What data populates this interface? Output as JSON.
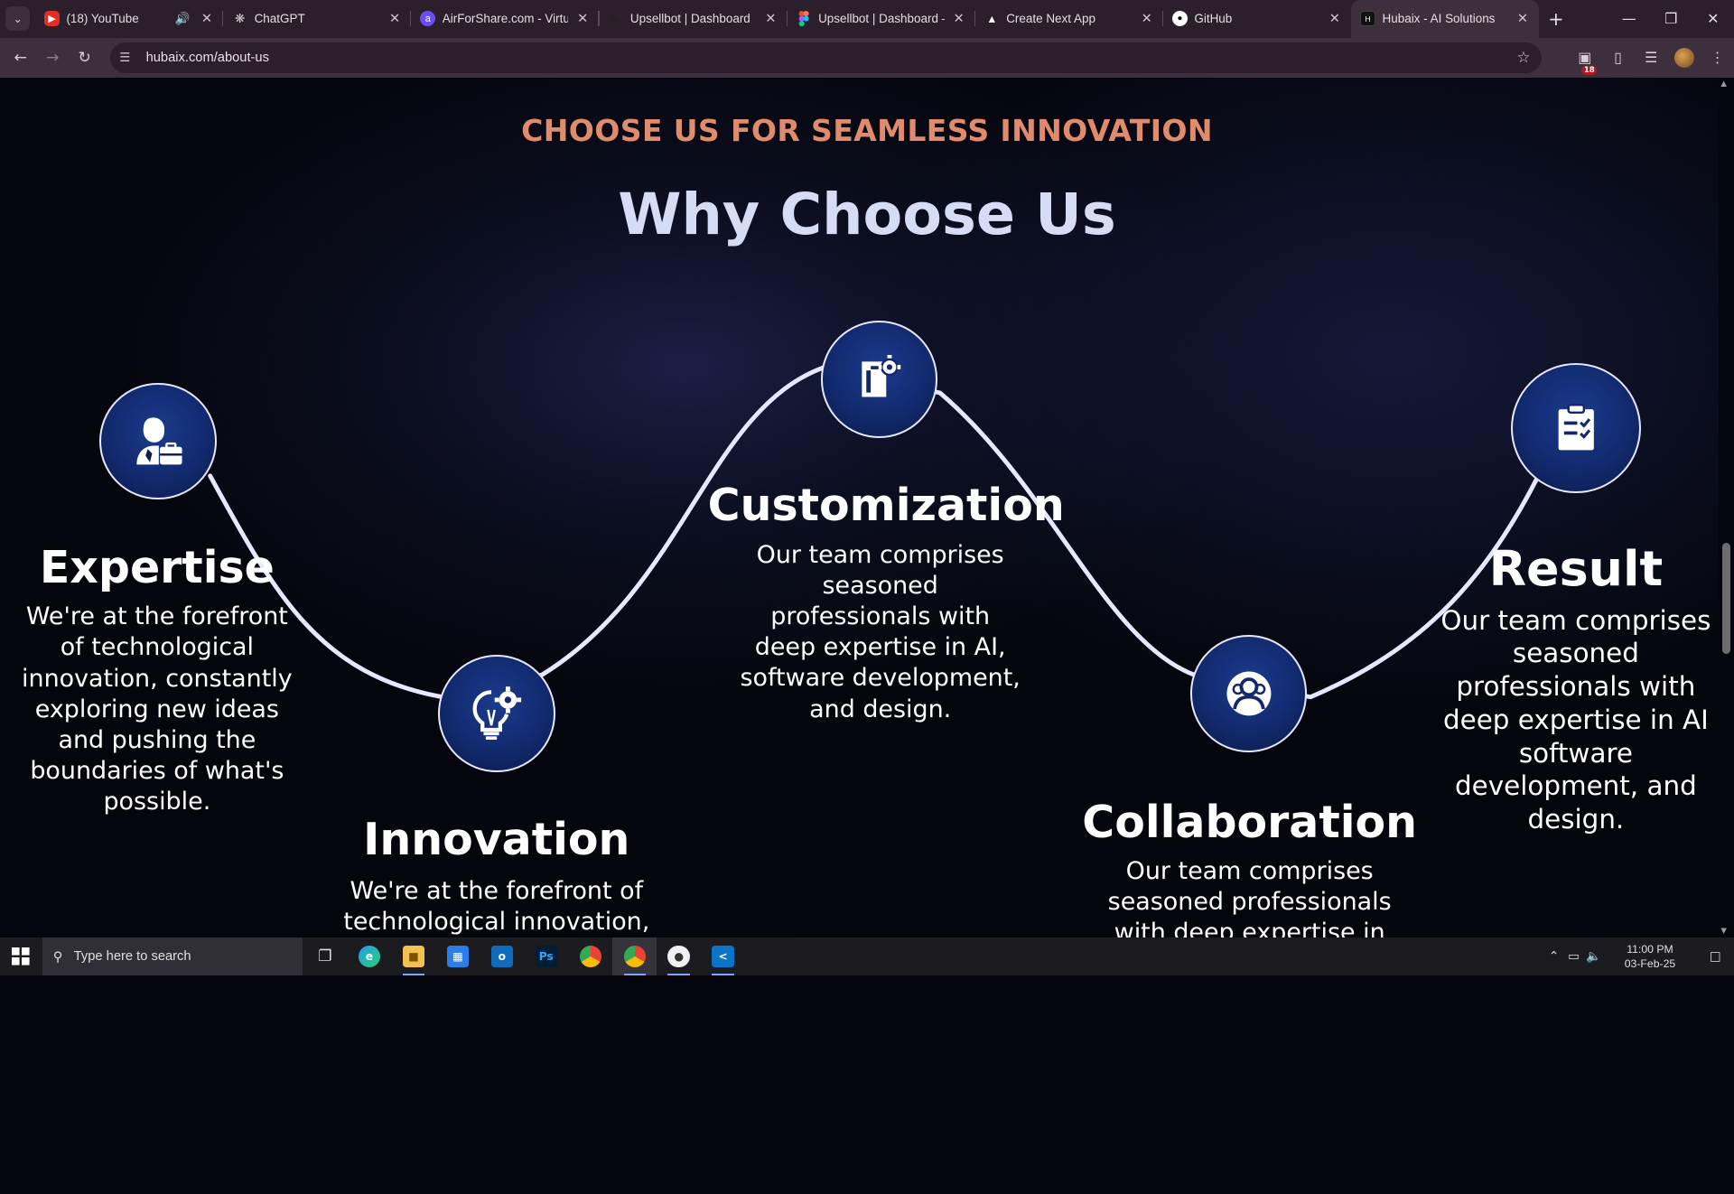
{
  "browser": {
    "tabs": [
      {
        "title": "(18) YouTube",
        "icon": "youtube-icon",
        "audio": true
      },
      {
        "title": "ChatGPT",
        "icon": "chatgpt-icon"
      },
      {
        "title": "AirForShare.com - Virtual",
        "icon": "airforshare-icon"
      },
      {
        "title": "Upsellbot | Dashboard",
        "icon": "upsellbot-icon"
      },
      {
        "title": "Upsellbot | Dashboard – F",
        "icon": "figma-icon"
      },
      {
        "title": "Create Next App",
        "icon": "next-icon"
      },
      {
        "title": "GitHub",
        "icon": "github-icon"
      },
      {
        "title": "Hubaix - AI Solutions",
        "icon": "hubaix-icon",
        "active": true
      }
    ],
    "url": "hubaix.com/about-us",
    "extension_badge": "18"
  },
  "page": {
    "eyebrow": "CHOOSE US FOR SEAMLESS INNOVATION",
    "heading": "Why Choose Us",
    "features": [
      {
        "title": "Expertise",
        "icon": "expert-briefcase-icon",
        "description": "We're at the forefront of technological innovation, constantly exploring new ideas and pushing the boundaries of what's possible."
      },
      {
        "title": "Innovation",
        "icon": "lightbulb-gear-icon",
        "description": "We're at the forefront of technological innovation,"
      },
      {
        "title": "Customization",
        "icon": "document-gear-icon",
        "description": "Our team comprises seasoned professionals with deep expertise in AI, software development, and design."
      },
      {
        "title": "Collaboration",
        "icon": "team-users-icon",
        "description": "Our team comprises seasoned professionals with deep expertise in AI,"
      },
      {
        "title": "Result",
        "icon": "clipboard-check-icon",
        "description": "Our team comprises seasoned professionals with deep expertise in AI software development, and design."
      }
    ]
  },
  "colors": {
    "eyebrow": "#e08b6b",
    "heading": "#d7dcf5",
    "node": "#122a6e",
    "curve": "#e6e8ff"
  },
  "taskbar": {
    "search_placeholder": "Type here to search",
    "apps": [
      "task-view-icon",
      "edge-icon",
      "file-explorer-icon",
      "store-icon",
      "outlook-icon",
      "photoshop-icon",
      "chrome-icon",
      "chrome-profile-icon",
      "chrome-canary-icon",
      "vscode-icon"
    ],
    "time": "11:00 PM",
    "date": "03-Feb-25"
  }
}
